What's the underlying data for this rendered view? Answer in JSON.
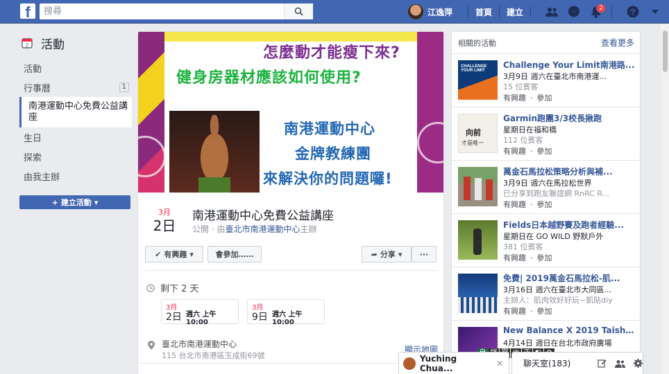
{
  "topbar": {
    "logo": "f",
    "search_placeholder": "搜尋",
    "user_name": "江逸萍",
    "home": "首頁",
    "create": "建立",
    "notifications_count": "2"
  },
  "left_nav": {
    "title": "活動",
    "items": [
      {
        "label": "活動",
        "count": ""
      },
      {
        "label": "行事曆",
        "count": "1"
      },
      {
        "label": "南港運動中心免費公益講座",
        "count": ""
      },
      {
        "label": "生日",
        "count": ""
      },
      {
        "label": "探索",
        "count": ""
      },
      {
        "label": "由我主辦",
        "count": ""
      }
    ],
    "create_button": "建立活動"
  },
  "cover": {
    "line1": "怎麼動才能瘦下來?",
    "line2": "健身房器材應該如何使用?",
    "line3": "南港運動中心",
    "line4": "金牌教練團",
    "line5": "來解決你的問題囉!"
  },
  "event": {
    "month": "3月",
    "day": "2日",
    "title": "南港運動中心免費公益講座",
    "privacy": "公開 · 由",
    "host": "臺北市南港運動中心",
    "host_suffix": "主辦",
    "interested": "有興趣",
    "going": "會參加……",
    "share": "分享",
    "more": "···",
    "remaining": "剩下 2 天",
    "dates": [
      {
        "month": "3月",
        "day": "2日",
        "time": "週六 上午10:00"
      },
      {
        "month": "3月",
        "day": "9日",
        "time": "週六 上午10:00"
      }
    ],
    "place_name": "臺北市南港運動中心",
    "place_address": "115 台北市南港區玉成街69號",
    "map_link": "顯示地圖"
  },
  "related": {
    "heading": "相關的活動",
    "see_more": "查看更多",
    "interested": "有興趣",
    "join": "參加",
    "items": [
      {
        "title": "Challenge Your Limit南港路...",
        "meta": "3月9日 週六在臺北市南港運...",
        "sub": "15 位賓客"
      },
      {
        "title": "Garmin跑團3/3校長揪跑",
        "meta": "星期日在福和橋",
        "sub": "112 位賓客"
      },
      {
        "title": "萬金石馬拉松策略分析與補...",
        "meta": "3月9日 週六在馬拉松世界",
        "sub": "已分享到跑友聯誼網 RnRC R..."
      },
      {
        "title": "Fields日本越野賽及跑者經驗...",
        "meta": "星期日在 GO WILD 野默戶外",
        "sub": "381 位賓客"
      },
      {
        "title": "免費| 2019萬金石馬拉松-肌...",
        "meta": "3月16日 週六在臺北市大同區...",
        "sub": "主辦人：肌肉效好好玩~凱貼diy"
      },
      {
        "title": "New Balance X 2019 Taishi...",
        "meta": "4月14日 週日在台北市政府廣場",
        "sub": ""
      }
    ]
  },
  "chat": {
    "contact": "Yuching Chua...",
    "close": "✕",
    "room": "聊天室(183)",
    "ime": [
      "自",
      "詳",
      "冟",
      "@",
      "正",
      "◧",
      "⚙"
    ]
  },
  "colors": {
    "brand": "#4267b2",
    "link": "#365899",
    "accent_red": "#f02849"
  }
}
